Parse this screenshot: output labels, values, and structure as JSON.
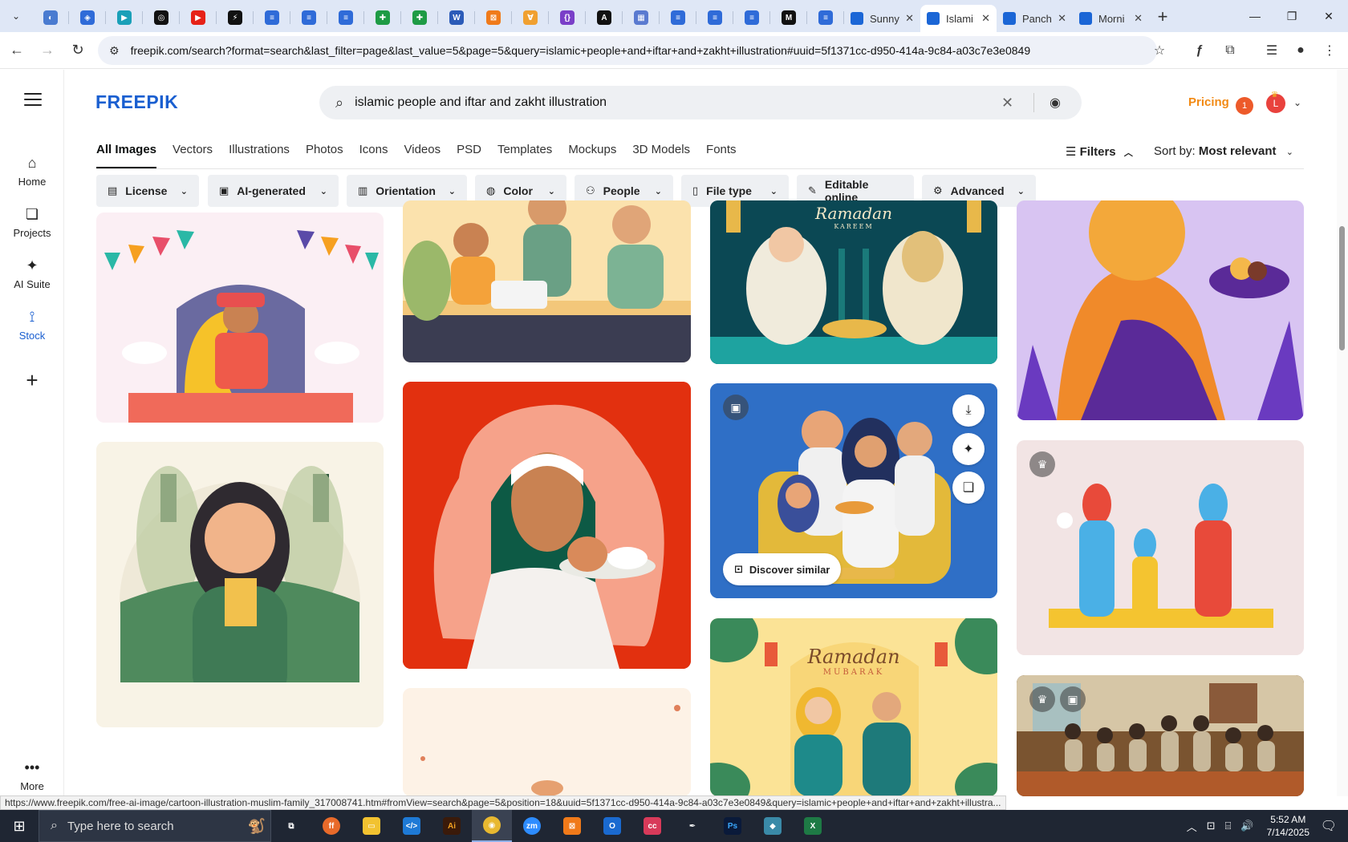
{
  "browser": {
    "pinned_tabs": [
      {
        "icon": "globe-icon",
        "color": "#4a7bd0",
        "glyph": "◐"
      },
      {
        "icon": "extension-icon",
        "color": "#2f6bd8",
        "glyph": "◈"
      },
      {
        "icon": "play-icon",
        "color": "#1aa0b8",
        "glyph": "▶"
      },
      {
        "icon": "openai-icon",
        "color": "#111111",
        "glyph": "◎"
      },
      {
        "icon": "youtube-icon",
        "color": "#e62117",
        "glyph": "▶"
      },
      {
        "icon": "bolt-icon",
        "color": "#111111",
        "glyph": "⚡"
      },
      {
        "icon": "docs-icon",
        "color": "#2f6bd8",
        "glyph": "≡"
      },
      {
        "icon": "docs-icon",
        "color": "#2f6bd8",
        "glyph": "≡"
      },
      {
        "icon": "docs-icon",
        "color": "#2f6bd8",
        "glyph": "≡"
      },
      {
        "icon": "sheets-icon",
        "color": "#1e9b45",
        "glyph": "✚"
      },
      {
        "icon": "sheets-icon",
        "color": "#1e9b45",
        "glyph": "✚"
      },
      {
        "icon": "word-icon",
        "color": "#2b5bb8",
        "glyph": "W"
      },
      {
        "icon": "xampp-icon",
        "color": "#f07a1a",
        "glyph": "⊠"
      },
      {
        "icon": "ribbon-icon",
        "color": "#f0a030",
        "glyph": "∀"
      },
      {
        "icon": "code-icon",
        "color": "#7a3fc8",
        "glyph": "{}"
      },
      {
        "icon": "font-icon",
        "color": "#111111",
        "glyph": "A"
      },
      {
        "icon": "grid-icon",
        "color": "#5a7ad0",
        "glyph": "▦"
      },
      {
        "icon": "docs-icon",
        "color": "#2f6bd8",
        "glyph": "≡"
      },
      {
        "icon": "docs-icon",
        "color": "#2f6bd8",
        "glyph": "≡"
      },
      {
        "icon": "docs-icon",
        "color": "#2f6bd8",
        "glyph": "≡"
      },
      {
        "icon": "medium-icon",
        "color": "#111111",
        "glyph": "M"
      },
      {
        "icon": "docs-icon",
        "color": "#2f6bd8",
        "glyph": "≡"
      }
    ],
    "tabs": [
      {
        "title": "Sunny",
        "active": false
      },
      {
        "title": "Islami",
        "active": true
      },
      {
        "title": "Panch",
        "active": false
      },
      {
        "title": "Morni",
        "active": false
      }
    ],
    "url": "freepik.com/search?format=search&last_filter=page&last_value=5&page=5&query=islamic+people+and+iftar+and+zakht+illustration#uuid=5f1371cc-d950-414a-9c84-a03c7e3e0849",
    "status_url": "https://www.freepik.com/free-ai-image/cartoon-illustration-muslim-family_317008741.htm#fromView=search&page=5&position=18&uuid=5f1371cc-d950-414a-9c84-a03c7e3e0849&query=islamic+people+and+iftar+and+zakht+illustra..."
  },
  "sidebar": {
    "items": [
      {
        "label": "Home",
        "icon": "home-icon"
      },
      {
        "label": "Projects",
        "icon": "projects-icon"
      },
      {
        "label": "AI Suite",
        "icon": "sparkle-icon"
      },
      {
        "label": "Stock",
        "icon": "stock-icon",
        "active": true
      }
    ],
    "more_label": "More"
  },
  "header": {
    "logo": "FREEPIK",
    "search_value": "islamic people and iftar and zakht illustration",
    "pricing": "Pricing",
    "notification_count": "1",
    "avatar_letter": "L"
  },
  "category_tabs": [
    "All Images",
    "Vectors",
    "Illustrations",
    "Photos",
    "Icons",
    "Videos",
    "PSD",
    "Templates",
    "Mockups",
    "3D Models",
    "Fonts"
  ],
  "filters_label": "Filters",
  "sort": {
    "label": "Sort by:",
    "value": "Most relevant"
  },
  "chips": [
    {
      "label": "License",
      "icon": "license-icon"
    },
    {
      "label": "AI-generated",
      "icon": "ai-icon"
    },
    {
      "label": "Orientation",
      "icon": "orientation-icon"
    },
    {
      "label": "Color",
      "icon": "palette-icon"
    },
    {
      "label": "People",
      "icon": "people-icon"
    },
    {
      "label": "File type",
      "icon": "file-icon"
    },
    {
      "label": "Editable online",
      "icon": "pencil-icon"
    },
    {
      "label": "Advanced",
      "icon": "gear-icon"
    }
  ],
  "cards": {
    "ramadan_kareem": {
      "title": "Ramadan",
      "subtitle": "KAREEM"
    },
    "ramadan_mubarak": {
      "title": "Ramadan",
      "subtitle": "MUBARAK"
    },
    "discover_similar": "Discover similar"
  },
  "taskbar": {
    "search_placeholder": "Type here to search",
    "time": "5:52 AM",
    "date": "7/14/2025"
  }
}
